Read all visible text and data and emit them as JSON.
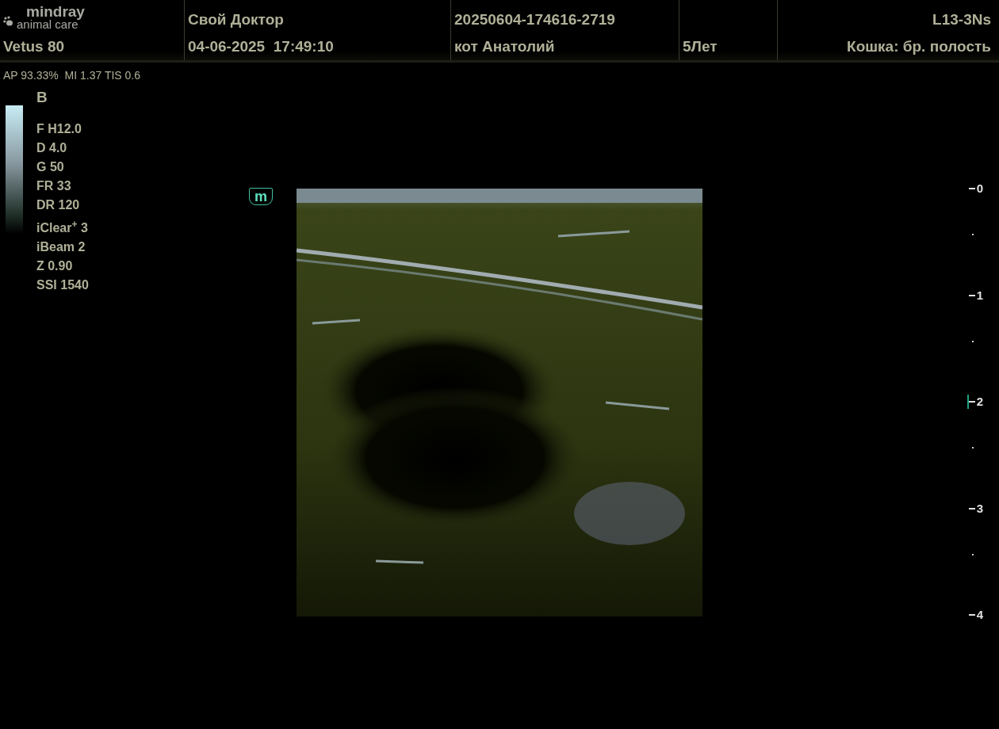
{
  "header": {
    "logo": {
      "brand": "mindray",
      "tagline": "animal care"
    },
    "model": "Vetus 80",
    "columns": [
      {
        "top": "Свой Доктор",
        "bottom": "04-06-2025  17:49:10"
      },
      {
        "top": "20250604-174616-2719",
        "bottom": "кот Анатолий"
      },
      {
        "bottom": "5Лет"
      }
    ],
    "probe": "L13-3Ns",
    "preset": "Кошка: бр. полость"
  },
  "acoustic": "AP 93.33%  MI 1.37 TIS 0.6",
  "mode": "B",
  "parameters": [
    "F H12.0",
    "D 4.0",
    "G 50",
    "FR 33",
    "DR 120",
    "iClear$^{+}$ 3",
    "iBeam 2",
    "Z 0.90",
    "SSI 1540"
  ],
  "orientation_marker": "m",
  "depth_scale": [
    {
      "label": "0",
      "focus": false
    },
    {
      "label": "1",
      "focus": false
    },
    {
      "label": "2",
      "focus": true
    },
    {
      "label": "3",
      "focus": false
    },
    {
      "label": "4",
      "focus": false
    }
  ]
}
